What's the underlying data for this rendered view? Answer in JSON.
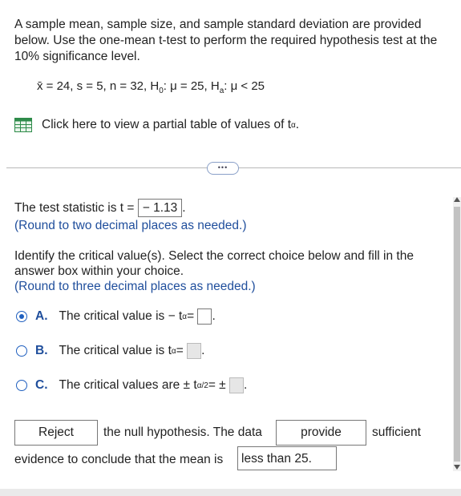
{
  "question": {
    "text": "A sample mean, sample size, and sample standard deviation are provided below. Use the one-mean t-test to perform the required hypothesis test at the 10% significance level."
  },
  "given": {
    "xbar": "x̄ = 24, s = 5, n = 32, H",
    "h0_sub": "0",
    "h0_rest": ": μ = 25, H",
    "ha_sub": "a",
    "ha_rest": ": μ < 25"
  },
  "table_link": {
    "label": "Click here to view a partial table of values of t",
    "sub": "α",
    "end": "."
  },
  "more_button": {
    "label": "•••"
  },
  "test_statistic": {
    "prefix": "The test statistic is t =",
    "value": "− 1.13",
    "suffix": ".",
    "round_note": "(Round to two decimal places as needed.)"
  },
  "critical": {
    "prompt": "Identify the critical value(s). Select the correct choice below and fill in the answer box within your choice.",
    "round_note": "(Round to three decimal places as needed.)",
    "choices": [
      {
        "letter": "A.",
        "text": "The critical value is  − t",
        "sub": "α",
        "eq": " =",
        "end": ".",
        "selected": true
      },
      {
        "letter": "B.",
        "text": "The critical value is t",
        "sub": "α",
        "eq": " =",
        "end": ".",
        "selected": false
      },
      {
        "letter": "C.",
        "text": "The critical values are  ± t",
        "sub": "α/2",
        "eq": " = ±",
        "end": ".",
        "selected": false
      }
    ]
  },
  "conclusion": {
    "decision": "Reject",
    "text1": "the null hypothesis. The data",
    "provide": "provide",
    "text2": "sufficient",
    "line2": "evidence to conclude that the mean is",
    "direction": "less than 25."
  },
  "colors": {
    "accent": "#1f4e9c",
    "radio": "#1f5fbf"
  }
}
